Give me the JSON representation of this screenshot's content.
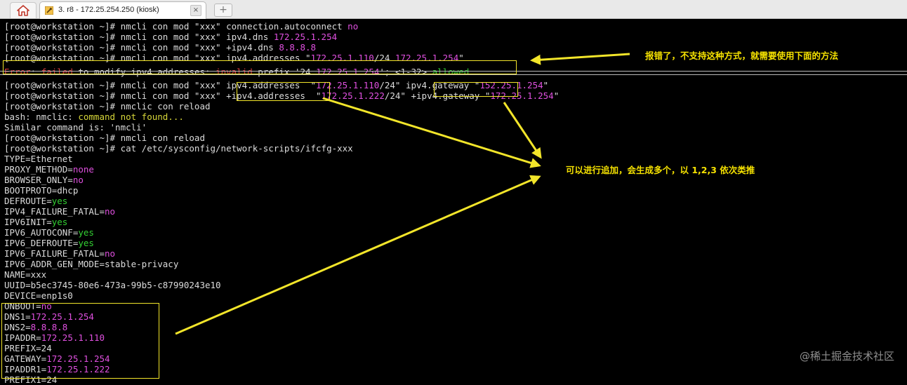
{
  "tabbar": {
    "home_icon": "home-icon",
    "tab_title": "3. r8 - 172.25.254.250 (kiosk)",
    "tab_icon": "wrench-icon",
    "close_glyph": "×",
    "new_tab_glyph": "+"
  },
  "terminal": {
    "lines": [
      [
        {
          "t": "[root@workstation ~]# nmcli con mod \"xxx\" connection.autoconnect "
        },
        {
          "t": "no",
          "c": "mag"
        }
      ],
      [
        {
          "t": "[root@workstation ~]# nmcli con mod \"xxx\" ipv4.dns "
        },
        {
          "t": "172.25.1.254",
          "c": "mag"
        }
      ],
      [
        {
          "t": "[root@workstation ~]# nmcli con mod \"xxx\" +ipv4.dns "
        },
        {
          "t": "8.8.8.8",
          "c": "mag"
        }
      ],
      [
        {
          "t": "[root@workstation ~]# nmcli con mod \"xxx\" ipv4.addresses \""
        },
        {
          "t": "172.25.1.110",
          "c": "mag"
        },
        {
          "t": "/24 "
        },
        {
          "t": "172.25.1.254",
          "c": "mag"
        },
        {
          "t": "\""
        }
      ],
      [
        {
          "t": "Error",
          "c": "red"
        },
        {
          "t": ": "
        },
        {
          "t": "failed",
          "c": "red"
        },
        {
          "t": " to modify ipv4.addresses: "
        },
        {
          "t": "invalid",
          "c": "red"
        },
        {
          "t": " prefix '24 "
        },
        {
          "t": "172.25.1.254",
          "c": "mag"
        },
        {
          "t": "'; <1-32> "
        },
        {
          "t": "allowed.",
          "c": "grn"
        }
      ],
      [
        {
          "t": "[root@workstation ~]# nmcli con mod \"xxx\" ipv4.addresses  \""
        },
        {
          "t": "172.25.1.110",
          "c": "mag"
        },
        {
          "t": "/24\" ipv4.gateway \""
        },
        {
          "t": "152.25.1.254",
          "c": "mag"
        },
        {
          "t": "\""
        }
      ],
      [
        {
          "t": "[root@workstation ~]# nmcli con mod \"xxx\" +ipv4.addresses  \""
        },
        {
          "t": "172.25.1.222",
          "c": "mag"
        },
        {
          "t": "/24\" +ipv4.gateway \""
        },
        {
          "t": "172.25.1.254",
          "c": "mag"
        },
        {
          "t": "\""
        }
      ],
      [
        {
          "t": "[root@workstation ~]# nmclic con reload"
        }
      ],
      [
        {
          "t": "bash: nmclic: "
        },
        {
          "t": "command not found...",
          "c": "yel"
        }
      ],
      [
        {
          "t": "Similar command is: 'nmcli'"
        }
      ],
      [
        {
          "t": "[root@workstation ~]# nmcli con reload"
        }
      ],
      [
        {
          "t": "[root@workstation ~]# cat /etc/sysconfig/network-scripts/ifcfg-xxx"
        }
      ],
      [
        {
          "t": "TYPE=Ethernet"
        }
      ],
      [
        {
          "t": "PROXY_METHOD="
        },
        {
          "t": "none",
          "c": "mag"
        }
      ],
      [
        {
          "t": "BROWSER_ONLY="
        },
        {
          "t": "no",
          "c": "mag"
        }
      ],
      [
        {
          "t": "BOOTPROTO=dhcp"
        }
      ],
      [
        {
          "t": "DEFROUTE="
        },
        {
          "t": "yes",
          "c": "grn"
        }
      ],
      [
        {
          "t": "IPV4_FAILURE_FATAL="
        },
        {
          "t": "no",
          "c": "mag"
        }
      ],
      [
        {
          "t": "IPV6INIT="
        },
        {
          "t": "yes",
          "c": "grn"
        }
      ],
      [
        {
          "t": "IPV6_AUTOCONF="
        },
        {
          "t": "yes",
          "c": "grn"
        }
      ],
      [
        {
          "t": "IPV6_DEFROUTE="
        },
        {
          "t": "yes",
          "c": "grn"
        }
      ],
      [
        {
          "t": "IPV6_FAILURE_FATAL="
        },
        {
          "t": "no",
          "c": "mag"
        }
      ],
      [
        {
          "t": "IPV6_ADDR_GEN_MODE=stable-privacy"
        }
      ],
      [
        {
          "t": "NAME=xxx"
        }
      ],
      [
        {
          "t": "UUID=b5ec3745-80e6-473a-99b5-c87990243e10"
        }
      ],
      [
        {
          "t": "DEVICE=enp1s0"
        }
      ],
      [
        {
          "t": "ONBOOT="
        },
        {
          "t": "no",
          "c": "mag"
        }
      ],
      [
        {
          "t": "DNS1="
        },
        {
          "t": "172.25.1.254",
          "c": "mag"
        }
      ],
      [
        {
          "t": "DNS2="
        },
        {
          "t": "8.8.8.8",
          "c": "mag"
        }
      ],
      [
        {
          "t": "IPADDR="
        },
        {
          "t": "172.25.1.110",
          "c": "mag"
        }
      ],
      [
        {
          "t": "PREFIX=24"
        }
      ],
      [
        {
          "t": "GATEWAY="
        },
        {
          "t": "172.25.1.254",
          "c": "mag"
        }
      ],
      [
        {
          "t": "IPADDR1="
        },
        {
          "t": "172.25.1.222",
          "c": "mag"
        }
      ],
      [
        {
          "t": "PREFIX1=24"
        }
      ]
    ]
  },
  "annotations": {
    "note_error": "报错了，不支持这种方式，就需要使用下面的方法",
    "note_append": "可以进行追加，会生成多个，以 1,2,3 依次类推"
  },
  "watermark": "@稀土掘金技术社区",
  "colors": {
    "background": "#000000",
    "text": "#dcdcdc",
    "magenta": "#e050e0",
    "red": "#e04040",
    "green": "#33d033",
    "yellow": "#d7d73a",
    "annotation": "#f5e100"
  }
}
